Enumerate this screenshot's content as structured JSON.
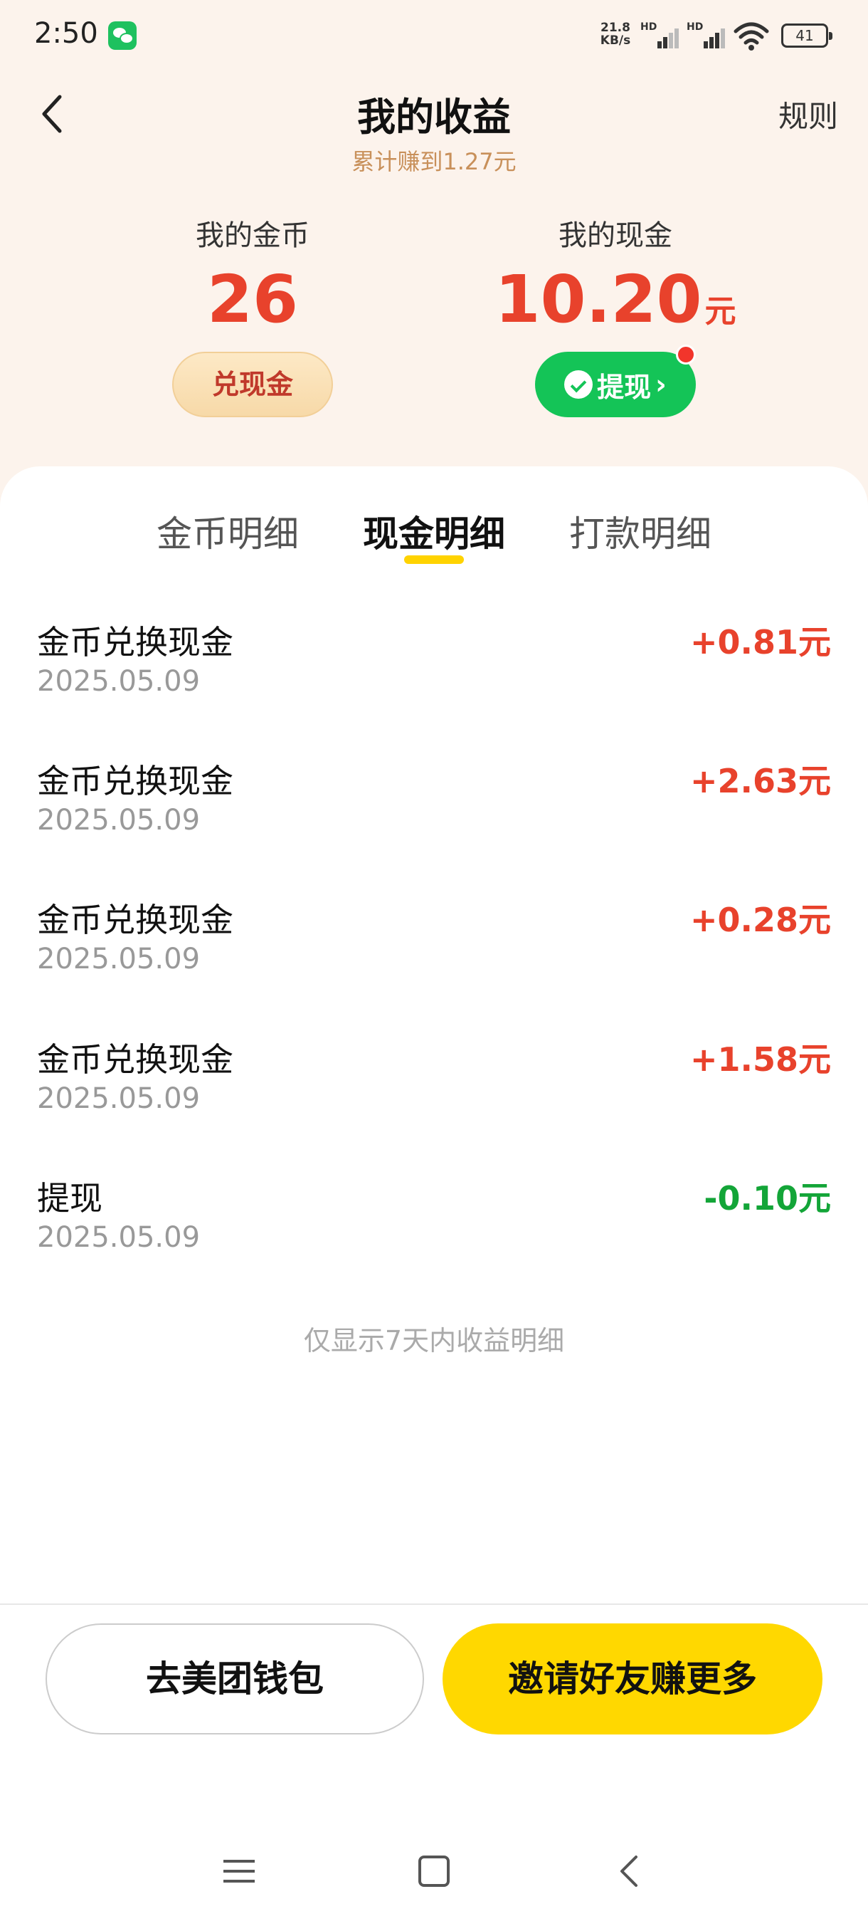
{
  "status_bar": {
    "time": "2:50",
    "net_speed_value": "21.8",
    "net_speed_unit": "KB/s",
    "sim1_label": "HD",
    "sim2_label": "HD",
    "battery": "41"
  },
  "header": {
    "title": "我的收益",
    "subtitle": "累计赚到1.27元",
    "rules_label": "规则"
  },
  "balances": {
    "coins_label": "我的金币",
    "coins_value": "26",
    "exchange_button": "兑现金",
    "cash_label": "我的现金",
    "cash_value": "10.20",
    "cash_unit": "元",
    "withdraw_button": "提现",
    "withdraw_chevron": "›"
  },
  "tabs": [
    {
      "label": "金币明细",
      "active": false
    },
    {
      "label": "现金明细",
      "active": true
    },
    {
      "label": "打款明细",
      "active": false
    }
  ],
  "transactions": [
    {
      "title": "金币兑换现金",
      "date": "2025.05.09",
      "amount": "+0.81元"
    },
    {
      "title": "金币兑换现金",
      "date": "2025.05.09",
      "amount": "+2.63元"
    },
    {
      "title": "金币兑换现金",
      "date": "2025.05.09",
      "amount": "+0.28元"
    },
    {
      "title": "金币兑换现金",
      "date": "2025.05.09",
      "amount": "+1.58元"
    },
    {
      "title": "提现",
      "date": "2025.05.09",
      "amount": "-0.10元"
    }
  ],
  "footer_note": "仅显示7天内收益明细",
  "actions": {
    "wallet_button": "去美团钱包",
    "invite_button": "邀请好友赚更多"
  },
  "colors": {
    "accent_red": "#e8422c",
    "accent_green": "#13a538",
    "accent_yellow": "#ffd800",
    "header_bg": "#fcf3ec"
  },
  "icons": {
    "back": "chevron-left-icon",
    "wechat_status": "wechat-icon",
    "withdraw": "wechat-pay-icon",
    "wifi": "wifi-icon",
    "battery": "battery-icon"
  }
}
